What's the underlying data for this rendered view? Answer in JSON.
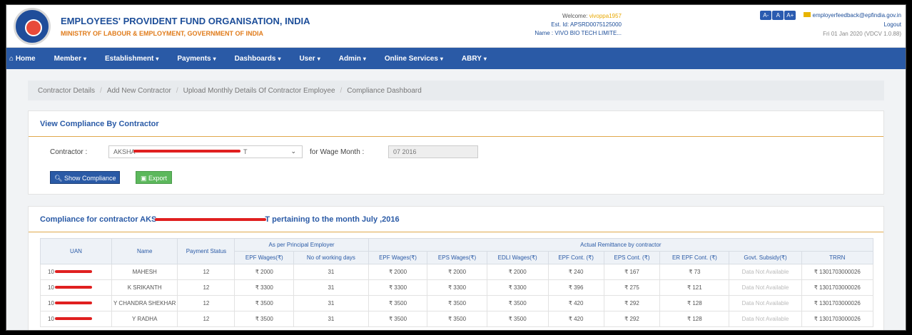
{
  "header": {
    "org_title": "EMPLOYEES' PROVIDENT FUND ORGANISATION, INDIA",
    "org_subtitle": "MINISTRY OF LABOUR & EMPLOYMENT, GOVERNMENT OF INDIA",
    "welcome_label": "Welcome:",
    "welcome_user": "vivoppa1957",
    "est_id": "Est. Id: APSRD0075125000",
    "name": "Name : VIVO BIO TECH LIMITE...",
    "a_buttons": [
      "A-",
      "A",
      "A+"
    ],
    "feedback_email": "employerfeedback@epfindia.gov.in",
    "logout": "Logout",
    "datetime": "Fri 01 Jan 2020 (VDCV 1.0.88)"
  },
  "nav": [
    {
      "label": "Home",
      "caret": false
    },
    {
      "label": "Member",
      "caret": true
    },
    {
      "label": "Establishment",
      "caret": true
    },
    {
      "label": "Payments",
      "caret": true
    },
    {
      "label": "Dashboards",
      "caret": true
    },
    {
      "label": "User",
      "caret": true
    },
    {
      "label": "Admin",
      "caret": true
    },
    {
      "label": "Online Services",
      "caret": true
    },
    {
      "label": "ABRY",
      "caret": true
    }
  ],
  "breadcrumb": [
    "Contractor Details",
    "Add New Contractor",
    "Upload Monthly Details Of Contractor Employee",
    "Compliance Dashboard"
  ],
  "panel1": {
    "title": "View Compliance By Contractor",
    "contractor_label": "Contractor :",
    "contractor_value_start": "AKSHA",
    "contractor_value_end": "T",
    "wage_label": "for Wage Month :",
    "wage_value": "07 2016",
    "show_btn": "Show Compliance",
    "export_btn": "Export"
  },
  "panel2": {
    "title_start": "Compliance for contractor AKS",
    "title_end": "T pertaining to the month July ,2016"
  },
  "table": {
    "group_principal": "As per Principal Employer",
    "group_actual": "Actual Remittance by contractor",
    "headers": {
      "uan": "UAN",
      "name": "Name",
      "status": "Payment Status",
      "p_epf": "EPF Wages(₹)",
      "p_days": "No of working days",
      "a_epf": "EPF Wages(₹)",
      "a_eps": "EPS Wages(₹)",
      "a_edli": "EDLI Wages(₹)",
      "a_epfc": "EPF Cont. (₹)",
      "a_epsc": "EPS Cont. (₹)",
      "a_er": "ER EPF Cont. (₹)",
      "a_gov": "Govt. Subsidy(₹)",
      "a_trrn": "TRRN"
    },
    "rows": [
      {
        "uan": "10",
        "name": "MAHESH",
        "status": "12",
        "p_epf": "₹ 2000",
        "p_days": "31",
        "a_epf": "₹ 2000",
        "a_eps": "₹ 2000",
        "a_edli": "₹ 2000",
        "a_epfc": "₹ 240",
        "a_epsc": "₹ 167",
        "a_er": "₹ 73",
        "a_gov": "Data Not Available",
        "a_trrn": "₹ 1301703000026"
      },
      {
        "uan": "10",
        "name": "K SRIKANTH",
        "status": "12",
        "p_epf": "₹ 3300",
        "p_days": "31",
        "a_epf": "₹ 3300",
        "a_eps": "₹ 3300",
        "a_edli": "₹ 3300",
        "a_epfc": "₹ 396",
        "a_epsc": "₹ 275",
        "a_er": "₹ 121",
        "a_gov": "Data Not Available",
        "a_trrn": "₹ 1301703000026"
      },
      {
        "uan": "10",
        "name": "Y CHANDRA SHEKHAR",
        "status": "12",
        "p_epf": "₹ 3500",
        "p_days": "31",
        "a_epf": "₹ 3500",
        "a_eps": "₹ 3500",
        "a_edli": "₹ 3500",
        "a_epfc": "₹ 420",
        "a_epsc": "₹ 292",
        "a_er": "₹ 128",
        "a_gov": "Data Not Available",
        "a_trrn": "₹ 1301703000026"
      },
      {
        "uan": "10",
        "name": "Y RADHA",
        "status": "12",
        "p_epf": "₹ 3500",
        "p_days": "31",
        "a_epf": "₹ 3500",
        "a_eps": "₹ 3500",
        "a_edli": "₹ 3500",
        "a_epfc": "₹ 420",
        "a_epsc": "₹ 292",
        "a_er": "₹ 128",
        "a_gov": "Data Not Available",
        "a_trrn": "₹ 1301703000026"
      }
    ]
  }
}
